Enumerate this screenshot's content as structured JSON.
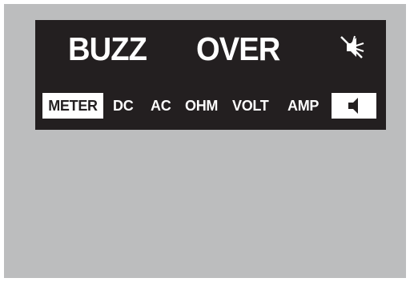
{
  "display": {
    "mode_word_1": "BUZZ",
    "mode_word_2": "OVER",
    "mute_icon": "speaker-off-icon",
    "labels": {
      "meter": "METER",
      "dc": "DC",
      "ac": "AC",
      "ohm": "OHM",
      "volt": "VOLT",
      "amp": "AMP"
    },
    "speaker_icon": "speaker-icon",
    "active_label": "meter"
  },
  "colors": {
    "lcd_background": "#231f20",
    "segment_on": "#ffffff",
    "bezel": "#bcbdbe"
  }
}
